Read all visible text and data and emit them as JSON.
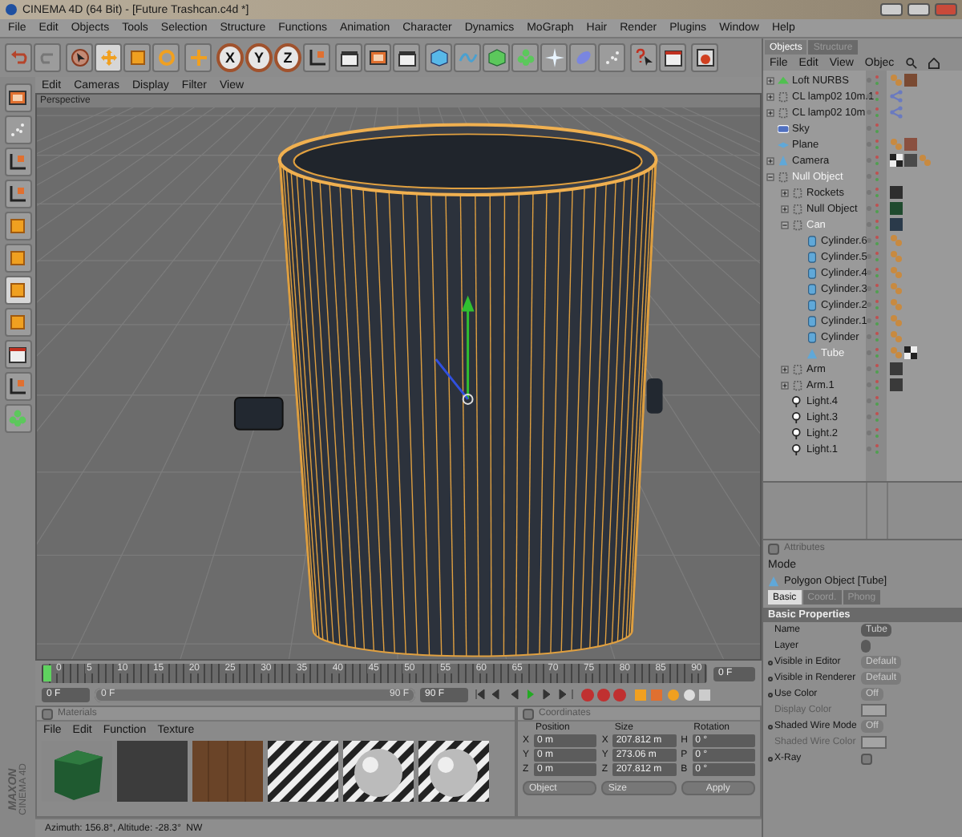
{
  "window": {
    "title": "CINEMA 4D (64 Bit) - [Future Trashcan.c4d *]"
  },
  "menu": [
    "File",
    "Edit",
    "Objects",
    "Tools",
    "Selection",
    "Structure",
    "Functions",
    "Animation",
    "Character",
    "Dynamics",
    "MoGraph",
    "Hair",
    "Render",
    "Plugins",
    "Window",
    "Help"
  ],
  "axis_buttons": [
    "X",
    "Y",
    "Z"
  ],
  "viewport": {
    "menu": [
      "Edit",
      "Cameras",
      "Display",
      "Filter",
      "View"
    ],
    "camera": "Perspective"
  },
  "timeline": {
    "ticks": [
      "0",
      "5",
      "10",
      "15",
      "20",
      "25",
      "30",
      "35",
      "40",
      "45",
      "50",
      "55",
      "60",
      "65",
      "70",
      "75",
      "80",
      "85",
      "90"
    ],
    "current_field": "0 F",
    "start_field": "0 F",
    "range_start": "0 F",
    "range_end": "90 F",
    "range_level": {
      "level": 1
    },
    "end_field": "90 F"
  },
  "materials": {
    "title": "Materials",
    "checked": false,
    "menu": [
      "File",
      "Edit",
      "Function",
      "Texture"
    ],
    "swatches": [
      {
        "kind": "cube"
      },
      {
        "kind": "dark"
      },
      {
        "kind": "wood"
      },
      {
        "kind": "stripes"
      },
      {
        "kind": "sphere"
      },
      {
        "kind": "sphere"
      }
    ]
  },
  "coordinates": {
    "title": "Coordinates",
    "checked": false,
    "headers": [
      "Position",
      "Size",
      "Rotation"
    ],
    "rows": [
      {
        "axes": [
          "X",
          "X",
          "H"
        ],
        "values": [
          "0 m",
          "207.812 m",
          "0 °"
        ]
      },
      {
        "axes": [
          "Y",
          "Y",
          "P"
        ],
        "values": [
          "0 m",
          "273.06 m",
          "0 °"
        ]
      },
      {
        "axes": [
          "Z",
          "Z",
          "B"
        ],
        "values": [
          "0 m",
          "207.812 m",
          "0 °"
        ]
      }
    ],
    "dropdowns": [
      "Object",
      "Size"
    ],
    "apply": "Apply"
  },
  "logo": [
    "MAXON",
    "CINEMA 4D"
  ],
  "status_bar": "Azimuth: 156.8°, Altitude: -28.3°  NW",
  "objects": {
    "tabs": [
      {
        "label": "Objects",
        "selected": true
      },
      {
        "label": "Structure",
        "selected": false
      }
    ],
    "menu": [
      "File",
      "Edit",
      "View",
      "Objec"
    ],
    "tree": [
      {
        "name": "Loft NURBS",
        "kind": "nurbs",
        "highlighted": false,
        "expanded": false,
        "tags": [
          {
            "kind": "phong"
          },
          {
            "kind": "material",
            "color": "#7a4a32"
          }
        ]
      },
      {
        "name": "CL lamp02 10m.1",
        "kind": "null",
        "highlighted": false,
        "expanded": false,
        "tags": [
          {
            "kind": "link"
          }
        ]
      },
      {
        "name": "CL lamp02 10m",
        "kind": "null",
        "highlighted": false,
        "expanded": false,
        "tags": [
          {
            "kind": "link"
          }
        ]
      },
      {
        "name": "Sky",
        "kind": "sky",
        "highlighted": false
      },
      {
        "name": "Plane",
        "kind": "plane",
        "highlighted": false,
        "tags": [
          {
            "kind": "phong"
          },
          {
            "kind": "material",
            "color": "#8a5040"
          }
        ]
      },
      {
        "name": "Camera",
        "kind": "camera",
        "highlighted": false,
        "expanded": false,
        "tags": [
          {
            "kind": "checker"
          },
          {
            "kind": "material",
            "color": "#4a4a4a"
          },
          {
            "kind": "phong"
          }
        ]
      },
      {
        "name": "Null Object",
        "kind": "null",
        "highlighted": true,
        "expanded": true,
        "children": [
          {
            "name": "Rockets",
            "kind": "null",
            "highlighted": false,
            "expanded": false,
            "tags": [
              {
                "kind": "material",
                "color": "#2e2e2e"
              }
            ]
          },
          {
            "name": "Null Object",
            "kind": "null",
            "highlighted": false,
            "expanded": false,
            "tags": [
              {
                "kind": "material",
                "color": "#1f4a2e"
              }
            ]
          },
          {
            "name": "Can",
            "kind": "null",
            "highlighted": true,
            "expanded": true,
            "tags": [
              {
                "kind": "material",
                "color": "#2a3a4a"
              }
            ],
            "children": [
              {
                "name": "Cylinder.6",
                "kind": "cylinder",
                "highlighted": false,
                "tags": [
                  {
                    "kind": "phong"
                  }
                ]
              },
              {
                "name": "Cylinder.5",
                "kind": "cylinder",
                "highlighted": false,
                "tags": [
                  {
                    "kind": "phong"
                  }
                ]
              },
              {
                "name": "Cylinder.4",
                "kind": "cylinder",
                "highlighted": false,
                "tags": [
                  {
                    "kind": "phong"
                  }
                ]
              },
              {
                "name": "Cylinder.3",
                "kind": "cylinder",
                "highlighted": false,
                "tags": [
                  {
                    "kind": "phong"
                  }
                ]
              },
              {
                "name": "Cylinder.2",
                "kind": "cylinder",
                "highlighted": false,
                "tags": [
                  {
                    "kind": "phong"
                  }
                ]
              },
              {
                "name": "Cylinder.1",
                "kind": "cylinder",
                "highlighted": false,
                "tags": [
                  {
                    "kind": "phong"
                  }
                ]
              },
              {
                "name": "Cylinder",
                "kind": "cylinder",
                "highlighted": false,
                "tags": [
                  {
                    "kind": "phong"
                  }
                ]
              },
              {
                "name": "Tube",
                "kind": "polygon",
                "highlighted": true,
                "tags": [
                  {
                    "kind": "phong"
                  },
                  {
                    "kind": "checker"
                  }
                ]
              }
            ]
          },
          {
            "name": "Arm",
            "kind": "null",
            "highlighted": false,
            "expanded": false,
            "tags": [
              {
                "kind": "material",
                "color": "#3a3a3a"
              }
            ]
          },
          {
            "name": "Arm.1",
            "kind": "null",
            "highlighted": false,
            "expanded": false,
            "tags": [
              {
                "kind": "material",
                "color": "#3a3a3a"
              }
            ]
          },
          {
            "name": "Light.4",
            "kind": "light",
            "highlighted": false
          },
          {
            "name": "Light.3",
            "kind": "light",
            "highlighted": false
          },
          {
            "name": "Light.2",
            "kind": "light",
            "highlighted": false
          },
          {
            "name": "Light.1",
            "kind": "light",
            "highlighted": false
          }
        ]
      }
    ]
  },
  "attributes": {
    "title": "Attributes",
    "checked": false,
    "mode": "Mode",
    "object": "Polygon Object [Tube]",
    "tabs": [
      {
        "label": "Basic",
        "selected": true
      },
      {
        "label": "Coord.",
        "selected": false
      },
      {
        "label": "Phong",
        "selected": false
      }
    ],
    "section": "Basic Properties",
    "rows": [
      {
        "label": "Name",
        "kind": "text",
        "value": "Tube",
        "keyable": false,
        "disabled": false
      },
      {
        "label": "Layer",
        "kind": "text",
        "keyable": false,
        "disabled": false
      },
      {
        "label": "Visible in Editor",
        "kind": "dropdown",
        "value": "Default",
        "keyable": true,
        "disabled": false
      },
      {
        "label": "Visible in Renderer",
        "kind": "dropdown",
        "value": "Default",
        "keyable": true,
        "disabled": false
      },
      {
        "label": "Use Color",
        "kind": "dropdown",
        "value": "Off",
        "keyable": true,
        "disabled": false
      },
      {
        "label": "Display Color",
        "kind": "color",
        "keyable": false,
        "disabled": true
      },
      {
        "label": "Shaded Wire Mode",
        "kind": "dropdown",
        "value": "Off",
        "keyable": true,
        "disabled": false
      },
      {
        "label": "Shaded Wire Color",
        "kind": "color",
        "keyable": false,
        "disabled": true
      },
      {
        "label": "X-Ray",
        "kind": "checkbox",
        "checked": false,
        "keyable": true,
        "disabled": false
      }
    ]
  }
}
